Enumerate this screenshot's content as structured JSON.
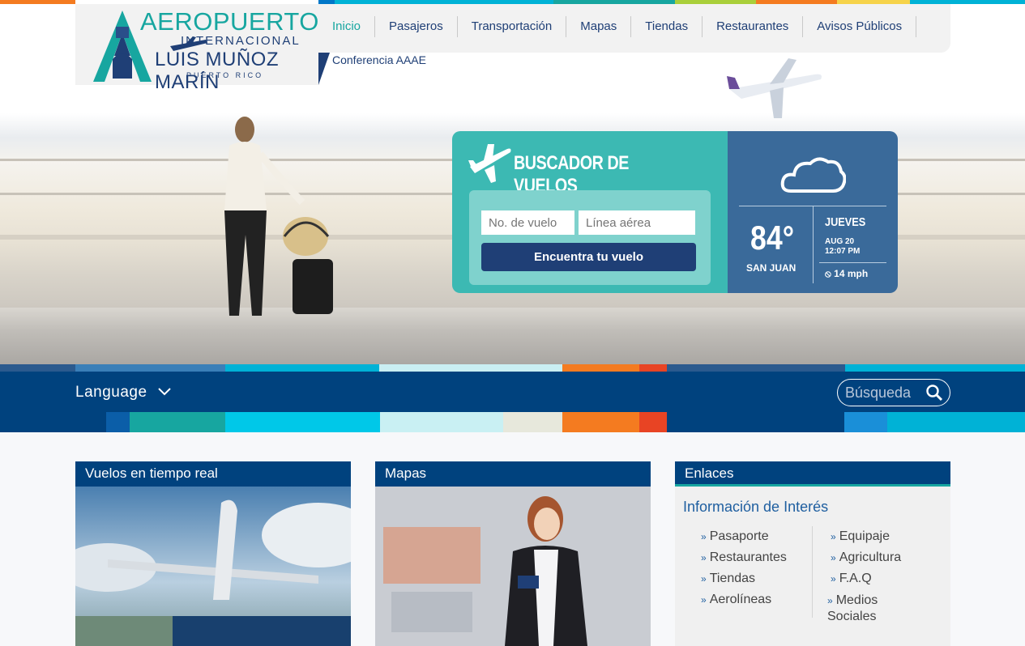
{
  "logo": {
    "line1": "AEROPUERTO",
    "line2": "INTERNACIONAL",
    "line3": "LUIS MUÑOZ MARÍN",
    "line4": "PUERTO RICO"
  },
  "nav": {
    "items": [
      {
        "label": "Inicio",
        "active": true
      },
      {
        "label": "Pasajeros"
      },
      {
        "label": "Transportación"
      },
      {
        "label": "Mapas"
      },
      {
        "label": "Tiendas"
      },
      {
        "label": "Restaurantes"
      },
      {
        "label": "Avisos Públicos"
      }
    ],
    "sub_label": "Conferencia AAAE"
  },
  "flight_search": {
    "title": "BUSCADOR DE VUELOS",
    "flight_no_placeholder": "No. de vuelo",
    "airline_placeholder": "Línea aérea",
    "button_label": "Encuentra tu vuelo"
  },
  "weather": {
    "icon": "cloud-icon",
    "temperature": "84°",
    "city": "SAN JUAN",
    "day": "JUEVES",
    "date": "AUG 20",
    "time": "12:07 PM",
    "wind": "14 mph"
  },
  "band": {
    "language_label": "Language",
    "search_placeholder": "Búsqueda"
  },
  "panels": {
    "realtime_title": "Vuelos en tiempo real",
    "maps_title": "Mapas",
    "links_title": "Enlaces",
    "links_subtitle": "Información de Interés",
    "links_left": [
      "Pasaporte",
      "Restaurantes",
      "Tiendas",
      "Aerolíneas"
    ],
    "links_right": [
      "Equipaje",
      "Agricultura",
      "F.A.Q",
      "Medios Sociales"
    ]
  },
  "colors": {
    "navy": "#00427e",
    "teal": "#17a6a0",
    "weather_blue": "#3a6a9a",
    "search_teal": "#3cb9b3"
  }
}
